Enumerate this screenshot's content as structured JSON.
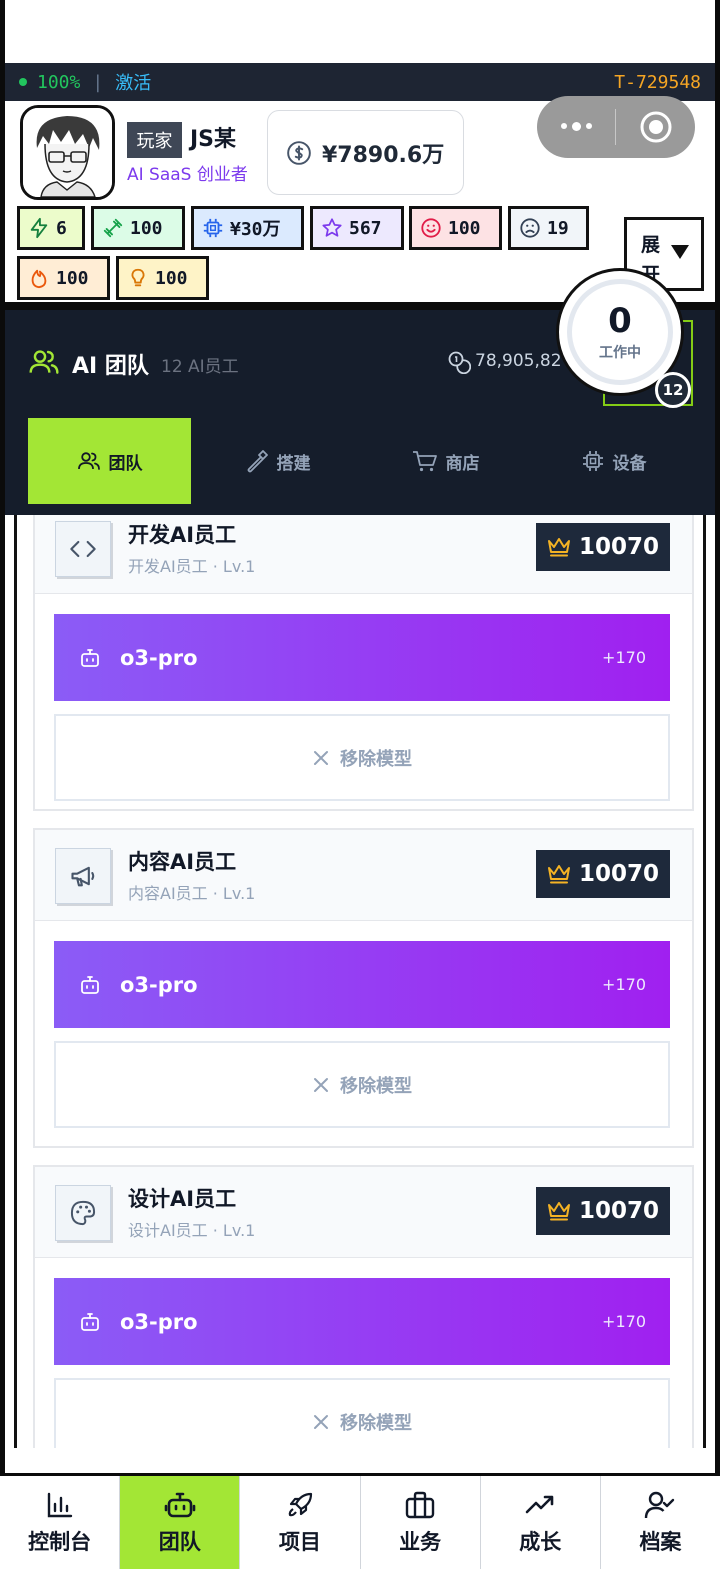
{
  "status": {
    "battery": "100%",
    "separator": "|",
    "activate_label": "激活",
    "code": "T-729548"
  },
  "profile": {
    "role": "玩家",
    "name": "JS某",
    "subtitle": "AI SaaS 创业者",
    "money": "¥7890.6万"
  },
  "stats": [
    {
      "icon": "lightning-icon",
      "value": "6",
      "bg": "#ecfccb",
      "color": "#15803d"
    },
    {
      "icon": "dumbbell-icon",
      "value": "100",
      "bg": "#dcfce7",
      "color": "#16a34a"
    },
    {
      "icon": "chip-icon",
      "value": "¥30万",
      "bg": "#dbeafe",
      "color": "#2563eb"
    },
    {
      "icon": "star-icon",
      "value": "567",
      "bg": "#ede9fe",
      "color": "#7c3aed"
    },
    {
      "icon": "smile-icon",
      "value": "100",
      "bg": "#fde2e4",
      "color": "#e11d48"
    },
    {
      "icon": "frown-icon",
      "value": "19",
      "bg": "#f1f5f9",
      "color": "#334155"
    },
    {
      "icon": "flame-icon",
      "value": "100",
      "bg": "#ffedd5",
      "color": "#ea580c"
    },
    {
      "icon": "bulb-icon",
      "value": "100",
      "bg": "#fef3c7",
      "color": "#d97706"
    }
  ],
  "expand": {
    "line1": "展",
    "line2": "开"
  },
  "team": {
    "title": "AI 团队",
    "count": "12 AI员工",
    "coins": "78,905,82",
    "working_count": "0",
    "working_label": "工作中",
    "badge": "12"
  },
  "tabs": [
    {
      "label": "团队",
      "icon": "users-icon",
      "active": true
    },
    {
      "label": "搭建",
      "icon": "hammer-icon",
      "active": false
    },
    {
      "label": "商店",
      "icon": "cart-icon",
      "active": false
    },
    {
      "label": "设备",
      "icon": "chip-icon",
      "active": false
    }
  ],
  "employees": [
    {
      "name": "开发AI员工",
      "sub": "开发AI员工 · Lv.1",
      "icon": "code-icon",
      "score": "10070",
      "model": "o3-pro",
      "bonus": "+170",
      "remove_label": "移除模型"
    },
    {
      "name": "内容AI员工",
      "sub": "内容AI员工 · Lv.1",
      "icon": "megaphone-icon",
      "score": "10070",
      "model": "o3-pro",
      "bonus": "+170",
      "remove_label": "移除模型"
    },
    {
      "name": "设计AI员工",
      "sub": "设计AI员工 · Lv.1",
      "icon": "palette-icon",
      "score": "10070",
      "model": "o3-pro",
      "bonus": "+170",
      "remove_label": "移除模型"
    }
  ],
  "nav": [
    {
      "label": "控制台",
      "icon": "bar-chart-icon",
      "active": false
    },
    {
      "label": "团队",
      "icon": "robot-icon",
      "active": true
    },
    {
      "label": "项目",
      "icon": "rocket-icon",
      "active": false
    },
    {
      "label": "业务",
      "icon": "briefcase-icon",
      "active": false
    },
    {
      "label": "成长",
      "icon": "trend-up-icon",
      "active": false
    },
    {
      "label": "档案",
      "icon": "user-check-icon",
      "active": false
    }
  ],
  "colors": {
    "accent_green": "#a3e635",
    "dark_header": "#151d2b",
    "model_gradient_start": "#8b5cf6",
    "model_gradient_end": "#a020f0"
  }
}
